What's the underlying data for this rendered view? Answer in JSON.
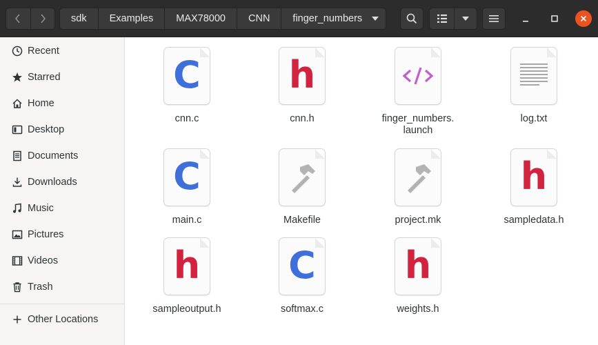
{
  "breadcrumb": {
    "items": [
      "sdk",
      "Examples",
      "MAX78000",
      "CNN",
      "finger_numbers"
    ]
  },
  "sidebar": {
    "items": [
      {
        "label": "Recent",
        "icon": "clock-icon"
      },
      {
        "label": "Starred",
        "icon": "star-icon"
      },
      {
        "label": "Home",
        "icon": "home-icon"
      },
      {
        "label": "Desktop",
        "icon": "desktop-icon"
      },
      {
        "label": "Documents",
        "icon": "documents-icon"
      },
      {
        "label": "Downloads",
        "icon": "download-icon"
      },
      {
        "label": "Music",
        "icon": "music-icon"
      },
      {
        "label": "Pictures",
        "icon": "pictures-icon"
      },
      {
        "label": "Videos",
        "icon": "videos-icon"
      },
      {
        "label": "Trash",
        "icon": "trash-icon"
      }
    ],
    "other_locations": {
      "label": "Other Locations",
      "icon": "plus-icon"
    }
  },
  "files": [
    {
      "name": "cnn.c",
      "icon": "c-source-icon"
    },
    {
      "name": "cnn.h",
      "icon": "c-header-icon"
    },
    {
      "name": "finger_numbers.\nlaunch",
      "icon": "xml-code-icon"
    },
    {
      "name": "log.txt",
      "icon": "text-file-icon"
    },
    {
      "name": "main.c",
      "icon": "c-source-icon"
    },
    {
      "name": "Makefile",
      "icon": "hammer-icon"
    },
    {
      "name": "project.mk",
      "icon": "hammer-icon"
    },
    {
      "name": "sampledata.h",
      "icon": "c-header-icon"
    },
    {
      "name": "sampleoutput.h",
      "icon": "c-header-icon"
    },
    {
      "name": "softmax.c",
      "icon": "c-source-icon"
    },
    {
      "name": "weights.h",
      "icon": "c-header-icon"
    }
  ],
  "glyphs": {
    "c": "C",
    "h": "h"
  },
  "colors": {
    "header": "#2c2c2c",
    "close": "#e95420",
    "c_icon": "#3f6fd8",
    "h_icon": "#d1233f",
    "code_icon": "#c061cb"
  }
}
